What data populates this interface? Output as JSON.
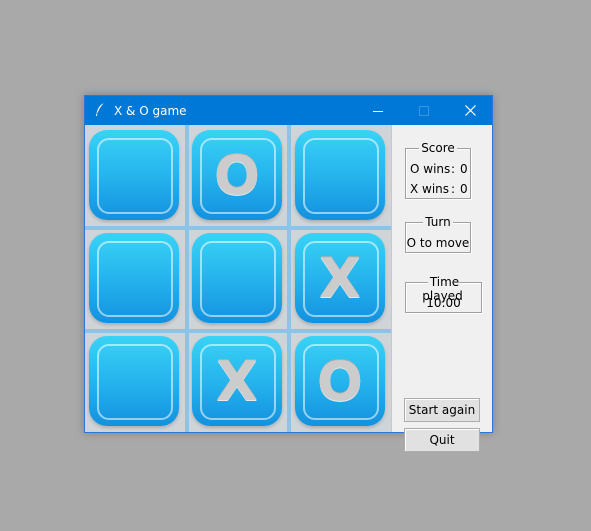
{
  "window": {
    "title": "X & O game",
    "icon": "feather-icon",
    "controls": [
      "minimize-icon",
      "maximize-icon",
      "close-icon"
    ],
    "titlebar_color": "#0078d7"
  },
  "board": {
    "tile_color": "#24b1ec",
    "mark_color": "#cccccc",
    "cells": [
      "",
      "O",
      "",
      "",
      "",
      "X",
      "",
      "X",
      "O"
    ]
  },
  "sidebar": {
    "score": {
      "title": "Score",
      "o_label": "O wins",
      "o_sep": ":",
      "o_value": "0",
      "x_label": "X wins",
      "x_sep": ":",
      "x_value": "0"
    },
    "turn": {
      "title": "Turn",
      "value": "O to move"
    },
    "time": {
      "title": "Time played",
      "value": "10:00"
    },
    "buttons": {
      "start_again": "Start again",
      "quit": "Quit"
    }
  }
}
